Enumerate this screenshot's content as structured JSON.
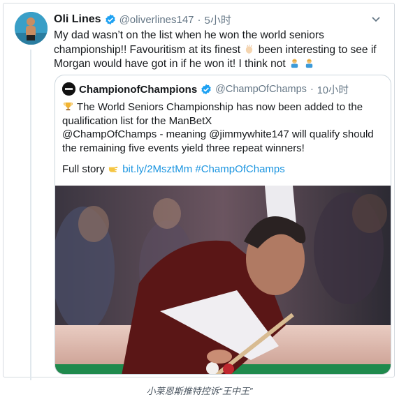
{
  "tweet": {
    "author_name": "Oli Lines",
    "author_handle": "@oliverlines147",
    "separator": "·",
    "time": "5小时",
    "text_1": "My dad wasn’t on the list when he won the world seniors championship!! Favouritism at its finest",
    "text_2": "been interesting to see if Morgan would have got in if he won it! I think not",
    "icons": {
      "verified": "verified-badge-icon",
      "menu": "chevron-down-icon",
      "emoji_clap": "clap-emoji-icon",
      "emoji_person": "man-shrugging-emoji-icon"
    }
  },
  "quote": {
    "author_name": "ChampionofChampions",
    "author_handle": "@ChampOfChamps",
    "separator": "·",
    "time": "10小时",
    "text_line_1": "The World Seniors Championship has now been added to the",
    "text_line_2": "qualification list for the ManBetX",
    "text_line_3": "@ChampOfChamps - meaning @jimmywhite147 will qualify should",
    "text_line_4": "the remaining five events yield three repeat winners!",
    "full_story_label": "Full story",
    "link": "bit.ly/2MsztMm",
    "hashtag": "#ChampOfChamps",
    "icons": {
      "trophy": "trophy-emoji-icon",
      "pointing": "pointing-right-emoji-icon"
    }
  },
  "caption": "小莱恩斯推特控诉“王中王”",
  "colors": {
    "link": "#1b95e0",
    "verified": "#1da1f2",
    "secondary": "#657786",
    "border": "#ccd6dd"
  }
}
